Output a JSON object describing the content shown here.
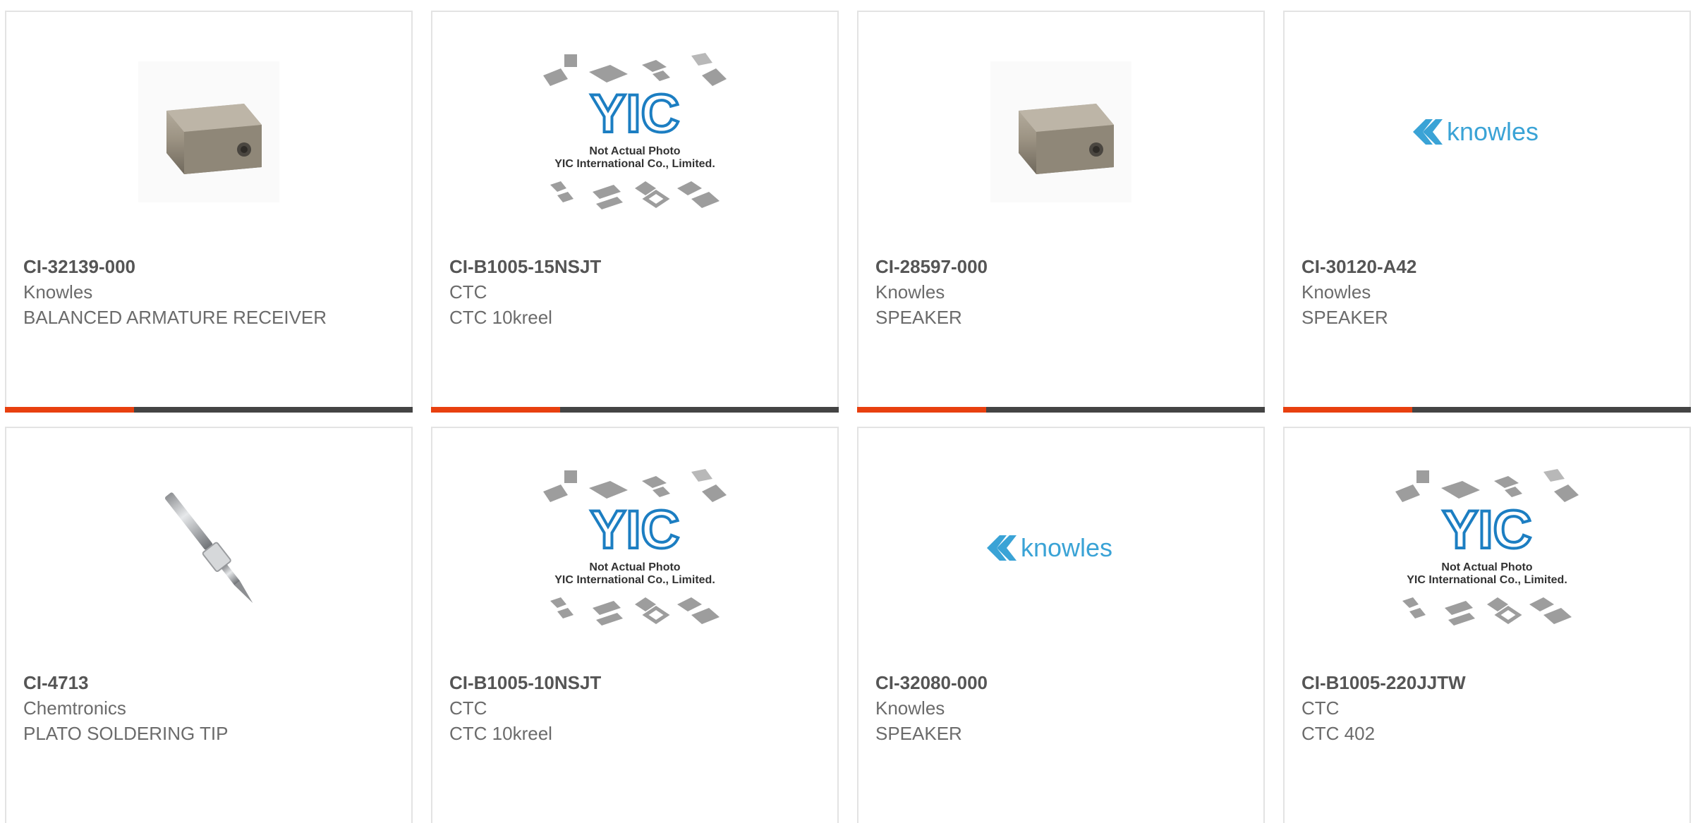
{
  "brand_colors": {
    "accent": "#e8400f",
    "bar": "#444444",
    "knowles_blue": "#3aa3d6",
    "yic_blue": "#1c7ec2"
  },
  "placeholder": {
    "line1": "Not Actual Photo",
    "line2": "YIC International Co., Limited."
  },
  "knowles_logo_text": "knowles",
  "products": [
    {
      "part": "CI-32139-000",
      "maker": "Knowles",
      "desc": "BALANCED ARMATURE RECEIVER",
      "image": "receiver-photo"
    },
    {
      "part": "CI-B1005-15NSJT",
      "maker": "CTC",
      "desc": "CTC 10kreel",
      "image": "yic-placeholder"
    },
    {
      "part": "CI-28597-000",
      "maker": "Knowles",
      "desc": "SPEAKER",
      "image": "receiver-photo"
    },
    {
      "part": "CI-30120-A42",
      "maker": "Knowles",
      "desc": "SPEAKER",
      "image": "knowles-logo"
    },
    {
      "part": "CI-4713",
      "maker": "Chemtronics",
      "desc": "PLATO SOLDERING TIP",
      "image": "soldering-tip-photo"
    },
    {
      "part": "CI-B1005-10NSJT",
      "maker": "CTC",
      "desc": "CTC 10kreel",
      "image": "yic-placeholder"
    },
    {
      "part": "CI-32080-000",
      "maker": "Knowles",
      "desc": "SPEAKER",
      "image": "knowles-logo"
    },
    {
      "part": "CI-B1005-220JJTW",
      "maker": "CTC",
      "desc": "CTC 402",
      "image": "yic-placeholder"
    }
  ]
}
